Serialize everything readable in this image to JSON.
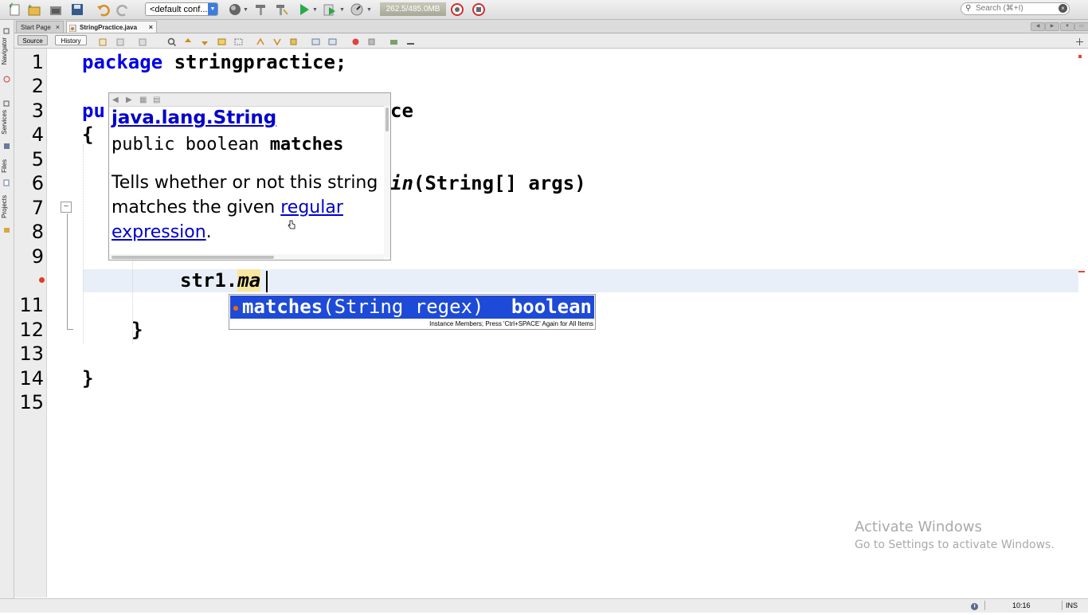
{
  "toolbar": {
    "config": "<default conf...",
    "memory": "262.5/485.0MB",
    "search_placeholder": "Search (⌘+I)"
  },
  "sidebar": {
    "items": [
      "Navigator",
      "Services",
      "Files",
      "Projects"
    ]
  },
  "tabs": [
    {
      "label": "Start Page",
      "active": false
    },
    {
      "label": "StringPractice.java",
      "active": true
    }
  ],
  "editor_toolbar": {
    "source_label": "Source",
    "history_label": "History"
  },
  "editor": {
    "line_numbers": [
      "1",
      "2",
      "3",
      "4",
      "5",
      "6",
      "7",
      "8",
      "9",
      "11",
      "12",
      "13",
      "14",
      "15"
    ],
    "lines": {
      "l1_kw": "package",
      "l1_rest": " stringpractice;",
      "l3_start": "pu",
      "l3_end": "ce",
      "l4": "{",
      "l6_method": "in",
      "l6_args": "(String[] args)",
      "l10_obj": "str1.",
      "l10_typed": "ma",
      "l12": "}",
      "l14": "}"
    }
  },
  "javadoc": {
    "class_link": "java.lang.String",
    "signature_prefix": "public boolean ",
    "signature_method": "matches",
    "description": "Tells whether or not this string matches the given",
    "description_link": "regular expression",
    "description_end": "."
  },
  "completion": {
    "method": "matches",
    "params": "(String regex)",
    "return_type": "boolean",
    "hint": "Instance Members; Press 'Ctrl+SPACE' Again for All Items"
  },
  "watermark": {
    "title": "Activate Windows",
    "subtitle": "Go to Settings to activate Windows."
  },
  "status": {
    "position": "10:16",
    "mode": "INS"
  },
  "colors": {
    "keyword": "#0000e6",
    "selection": "#1e4ad8",
    "current_line": "#e9eff8",
    "link": "#0000cc"
  }
}
